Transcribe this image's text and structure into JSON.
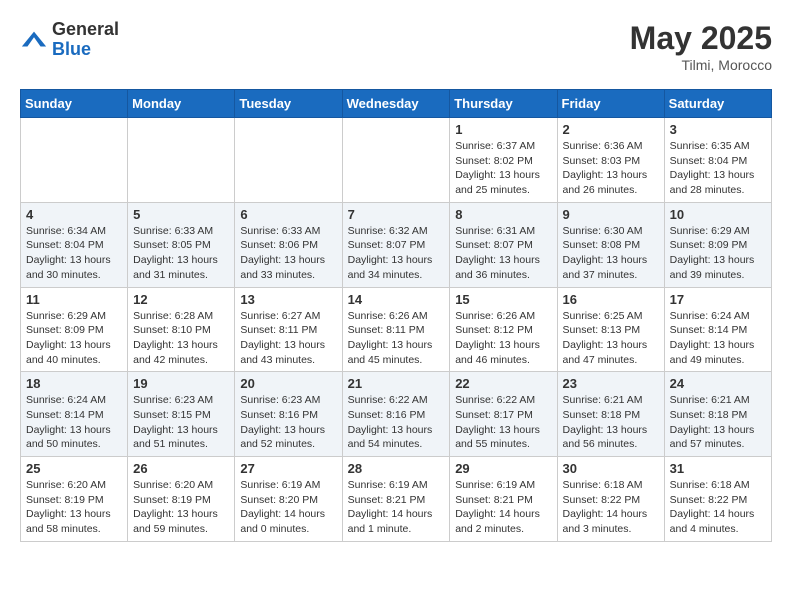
{
  "logo": {
    "general": "General",
    "blue": "Blue"
  },
  "title": {
    "month_year": "May 2025",
    "location": "Tilmi, Morocco"
  },
  "weekdays": [
    "Sunday",
    "Monday",
    "Tuesday",
    "Wednesday",
    "Thursday",
    "Friday",
    "Saturday"
  ],
  "weeks": [
    [
      {
        "day": "",
        "info": ""
      },
      {
        "day": "",
        "info": ""
      },
      {
        "day": "",
        "info": ""
      },
      {
        "day": "",
        "info": ""
      },
      {
        "day": "1",
        "info": "Sunrise: 6:37 AM\nSunset: 8:02 PM\nDaylight: 13 hours\nand 25 minutes."
      },
      {
        "day": "2",
        "info": "Sunrise: 6:36 AM\nSunset: 8:03 PM\nDaylight: 13 hours\nand 26 minutes."
      },
      {
        "day": "3",
        "info": "Sunrise: 6:35 AM\nSunset: 8:04 PM\nDaylight: 13 hours\nand 28 minutes."
      }
    ],
    [
      {
        "day": "4",
        "info": "Sunrise: 6:34 AM\nSunset: 8:04 PM\nDaylight: 13 hours\nand 30 minutes."
      },
      {
        "day": "5",
        "info": "Sunrise: 6:33 AM\nSunset: 8:05 PM\nDaylight: 13 hours\nand 31 minutes."
      },
      {
        "day": "6",
        "info": "Sunrise: 6:33 AM\nSunset: 8:06 PM\nDaylight: 13 hours\nand 33 minutes."
      },
      {
        "day": "7",
        "info": "Sunrise: 6:32 AM\nSunset: 8:07 PM\nDaylight: 13 hours\nand 34 minutes."
      },
      {
        "day": "8",
        "info": "Sunrise: 6:31 AM\nSunset: 8:07 PM\nDaylight: 13 hours\nand 36 minutes."
      },
      {
        "day": "9",
        "info": "Sunrise: 6:30 AM\nSunset: 8:08 PM\nDaylight: 13 hours\nand 37 minutes."
      },
      {
        "day": "10",
        "info": "Sunrise: 6:29 AM\nSunset: 8:09 PM\nDaylight: 13 hours\nand 39 minutes."
      }
    ],
    [
      {
        "day": "11",
        "info": "Sunrise: 6:29 AM\nSunset: 8:09 PM\nDaylight: 13 hours\nand 40 minutes."
      },
      {
        "day": "12",
        "info": "Sunrise: 6:28 AM\nSunset: 8:10 PM\nDaylight: 13 hours\nand 42 minutes."
      },
      {
        "day": "13",
        "info": "Sunrise: 6:27 AM\nSunset: 8:11 PM\nDaylight: 13 hours\nand 43 minutes."
      },
      {
        "day": "14",
        "info": "Sunrise: 6:26 AM\nSunset: 8:11 PM\nDaylight: 13 hours\nand 45 minutes."
      },
      {
        "day": "15",
        "info": "Sunrise: 6:26 AM\nSunset: 8:12 PM\nDaylight: 13 hours\nand 46 minutes."
      },
      {
        "day": "16",
        "info": "Sunrise: 6:25 AM\nSunset: 8:13 PM\nDaylight: 13 hours\nand 47 minutes."
      },
      {
        "day": "17",
        "info": "Sunrise: 6:24 AM\nSunset: 8:14 PM\nDaylight: 13 hours\nand 49 minutes."
      }
    ],
    [
      {
        "day": "18",
        "info": "Sunrise: 6:24 AM\nSunset: 8:14 PM\nDaylight: 13 hours\nand 50 minutes."
      },
      {
        "day": "19",
        "info": "Sunrise: 6:23 AM\nSunset: 8:15 PM\nDaylight: 13 hours\nand 51 minutes."
      },
      {
        "day": "20",
        "info": "Sunrise: 6:23 AM\nSunset: 8:16 PM\nDaylight: 13 hours\nand 52 minutes."
      },
      {
        "day": "21",
        "info": "Sunrise: 6:22 AM\nSunset: 8:16 PM\nDaylight: 13 hours\nand 54 minutes."
      },
      {
        "day": "22",
        "info": "Sunrise: 6:22 AM\nSunset: 8:17 PM\nDaylight: 13 hours\nand 55 minutes."
      },
      {
        "day": "23",
        "info": "Sunrise: 6:21 AM\nSunset: 8:18 PM\nDaylight: 13 hours\nand 56 minutes."
      },
      {
        "day": "24",
        "info": "Sunrise: 6:21 AM\nSunset: 8:18 PM\nDaylight: 13 hours\nand 57 minutes."
      }
    ],
    [
      {
        "day": "25",
        "info": "Sunrise: 6:20 AM\nSunset: 8:19 PM\nDaylight: 13 hours\nand 58 minutes."
      },
      {
        "day": "26",
        "info": "Sunrise: 6:20 AM\nSunset: 8:19 PM\nDaylight: 13 hours\nand 59 minutes."
      },
      {
        "day": "27",
        "info": "Sunrise: 6:19 AM\nSunset: 8:20 PM\nDaylight: 14 hours\nand 0 minutes."
      },
      {
        "day": "28",
        "info": "Sunrise: 6:19 AM\nSunset: 8:21 PM\nDaylight: 14 hours\nand 1 minute."
      },
      {
        "day": "29",
        "info": "Sunrise: 6:19 AM\nSunset: 8:21 PM\nDaylight: 14 hours\nand 2 minutes."
      },
      {
        "day": "30",
        "info": "Sunrise: 6:18 AM\nSunset: 8:22 PM\nDaylight: 14 hours\nand 3 minutes."
      },
      {
        "day": "31",
        "info": "Sunrise: 6:18 AM\nSunset: 8:22 PM\nDaylight: 14 hours\nand 4 minutes."
      }
    ]
  ]
}
